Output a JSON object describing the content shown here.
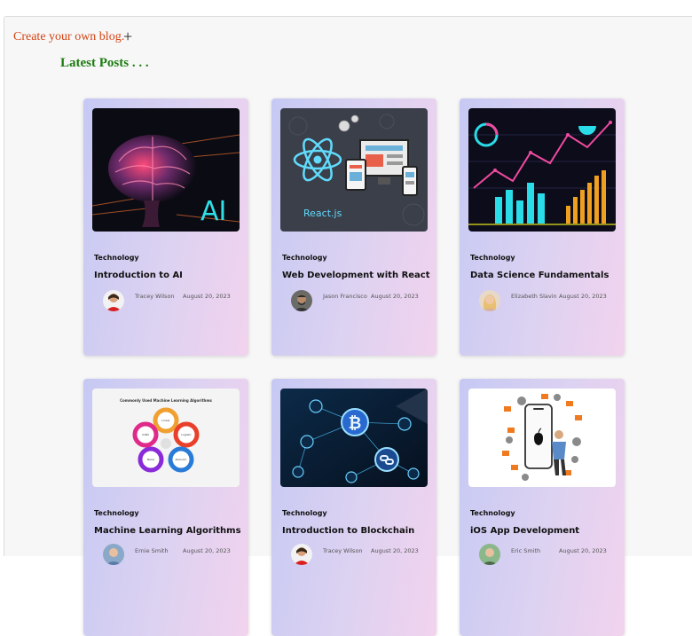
{
  "header": {
    "create_label": "Create your own blog.",
    "create_icon": "plus-icon",
    "plus_glyph": "+",
    "section_title": "Latest Posts . . ."
  },
  "posts": [
    {
      "category": "Technology",
      "title": "Introduction to AI",
      "author": "Tracey Wilson",
      "date": "August 20, 2023",
      "image": "ai-brain-image",
      "image_text": "AI"
    },
    {
      "category": "Technology",
      "title": "Web Development with React",
      "author": "Jason Francisco",
      "date": "August 20, 2023",
      "image": "reactjs-image",
      "image_text": "React.js"
    },
    {
      "category": "Technology",
      "title": "Data Science Fundamentals",
      "author": "Elizabeth Slavin",
      "date": "August 20, 2023",
      "image": "data-chart-image"
    },
    {
      "category": "Technology",
      "title": "Machine Learning Algorithms",
      "author": "Ernie Smith",
      "date": "August 20, 2023",
      "image": "ml-algorithms-image",
      "image_text": "Commonly Used Machine Learning Algorithms"
    },
    {
      "category": "Technology",
      "title": "Introduction to Blockchain",
      "author": "Tracey Wilson",
      "date": "August 20, 2023",
      "image": "blockchain-image"
    },
    {
      "category": "Technology",
      "title": "iOS App Development",
      "author": "Eric Smith",
      "date": "August 20, 2023",
      "image": "ios-dev-image"
    }
  ],
  "colors": {
    "create_link": "#d34414",
    "section_title": "#1b7c0f",
    "card_gradient_start": "#c6c9f4",
    "card_gradient_end": "#f2d3ee"
  }
}
